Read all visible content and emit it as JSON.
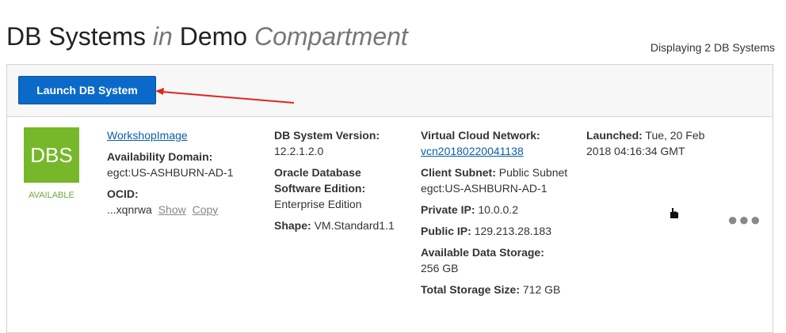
{
  "header": {
    "title_main": "DB Systems",
    "title_in": "in",
    "title_compartment_name": "Demo",
    "title_compartment_word": "Compartment",
    "display_count": "Displaying 2 DB Systems"
  },
  "toolbar": {
    "launch_label": "Launch DB System"
  },
  "system": {
    "tile_text": "DBS",
    "status": "AVAILABLE",
    "name": "WorkshopImage",
    "availability_domain_label": "Availability Domain:",
    "availability_domain": "egct:US-ASHBURN-AD-1",
    "ocid_label": "OCID:",
    "ocid_value": "...xqnrwa",
    "show_label": "Show",
    "copy_label": "Copy",
    "version_label": "DB System Version:",
    "version": "12.2.1.2.0",
    "edition_label": "Oracle Database Software Edition:",
    "edition": "Enterprise Edition",
    "shape_label": "Shape:",
    "shape": "VM.Standard1.1",
    "vcn_label": "Virtual Cloud Network:",
    "vcn": "vcn20180220041138",
    "subnet_label": "Client Subnet:",
    "subnet": "Public Subnet egct:US-ASHBURN-AD-1",
    "private_ip_label": "Private IP:",
    "private_ip": "10.0.0.2",
    "public_ip_label": "Public IP:",
    "public_ip": "129.213.28.183",
    "avail_storage_label": "Available Data Storage:",
    "avail_storage": "256 GB",
    "total_storage_label": "Total Storage Size:",
    "total_storage": "712 GB",
    "launched_label": "Launched:",
    "launched": "Tue, 20 Feb 2018 04:16:34 GMT"
  },
  "actions_icon": "more-actions-icon",
  "colors": {
    "button_blue": "#0b6ac9",
    "tile_green": "#76b82a",
    "link_blue": "#0b5ea8",
    "arrow_red": "#e0241b"
  }
}
